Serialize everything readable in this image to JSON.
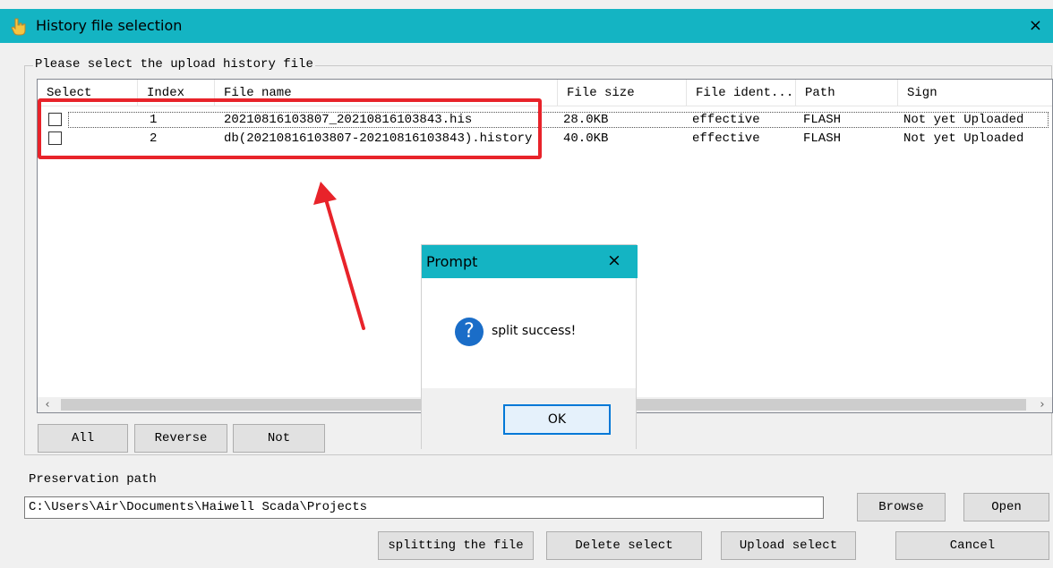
{
  "window": {
    "title": "History file selection",
    "close_glyph": "×",
    "icon": "hand-pointer-icon"
  },
  "group": {
    "legend": "Please select the upload history file"
  },
  "table": {
    "columns": [
      "Select",
      "Index",
      "File name",
      "File size",
      "File ident...",
      "Path",
      "Sign"
    ],
    "rows": [
      {
        "checked": false,
        "index": "1",
        "file_name": "20210816103807_20210816103843.his",
        "file_size": "28.0KB",
        "file_ident": "effective",
        "path": "FLASH",
        "sign": "Not yet Uploaded"
      },
      {
        "checked": false,
        "index": "2",
        "file_name": "db(20210816103807-20210816103843).history",
        "file_size": "40.0KB",
        "file_ident": "effective",
        "path": "FLASH",
        "sign": "Not yet Uploaded"
      }
    ]
  },
  "selection_buttons": {
    "all": "All",
    "reverse": "Reverse",
    "not": "Not"
  },
  "preservation": {
    "label": "Preservation path",
    "value": "C:\\Users\\Air\\Documents\\Haiwell Scada\\Projects",
    "browse": "Browse",
    "open": "Open"
  },
  "actions": {
    "split": "splitting the file",
    "delete": "Delete select",
    "upload": "Upload select",
    "cancel": "Cancel"
  },
  "dialog": {
    "title": "Prompt",
    "close_glyph": "×",
    "icon": "question-icon",
    "icon_glyph": "?",
    "message": "split success!",
    "ok": "OK"
  },
  "annotation": {
    "color": "#e8232a"
  },
  "scrollbar": {
    "left_glyph": "‹",
    "right_glyph": "›"
  }
}
